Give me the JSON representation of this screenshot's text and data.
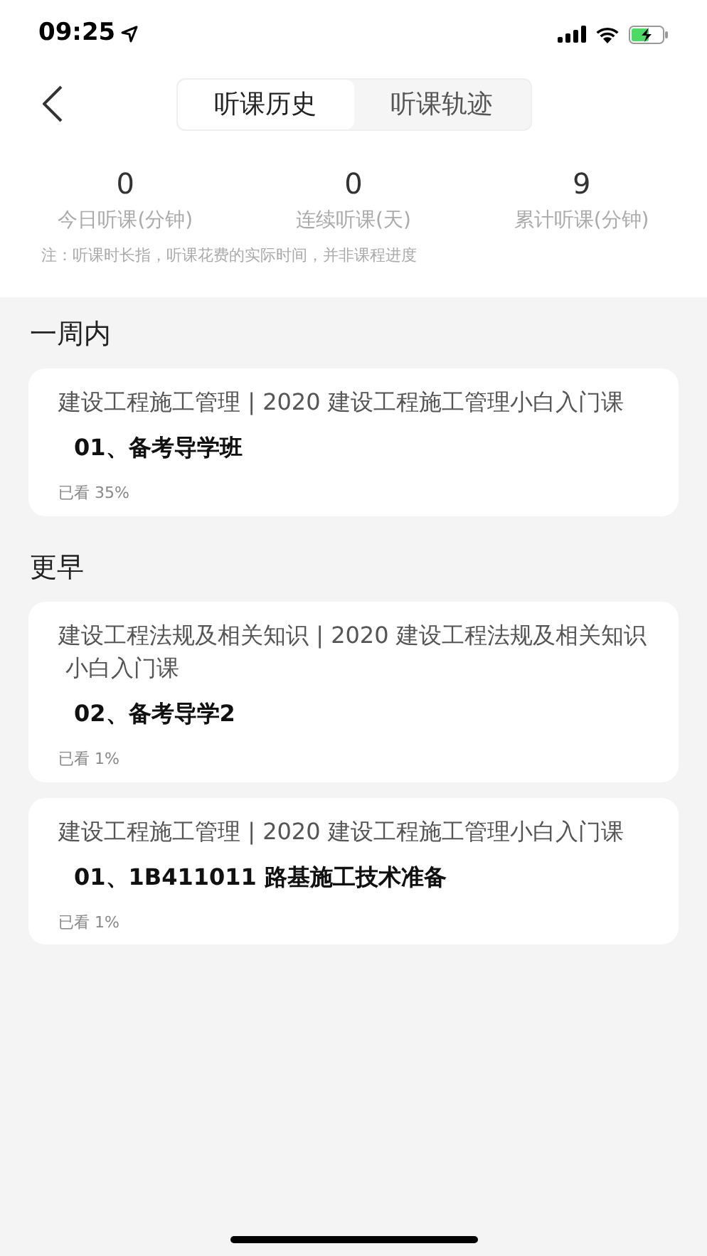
{
  "status_bar": {
    "time": "09:25"
  },
  "tabs": [
    {
      "label": "听课历史",
      "selected": true
    },
    {
      "label": "听课轨迹",
      "selected": false
    }
  ],
  "stats": [
    {
      "value": "0",
      "label": "今日听课(分钟)"
    },
    {
      "value": "0",
      "label": "连续听课(天)"
    },
    {
      "value": "9",
      "label": "累计听课(分钟)"
    }
  ],
  "note": "注：听课时长指，听课花费的实际时间，并非课程进度",
  "sections": [
    {
      "heading": "一周内",
      "items": [
        {
          "course": "建设工程施工管理 | 2020 建设工程施工管理小白入门课",
          "lesson": "01、备考导学班",
          "progress": "已看 35%"
        }
      ]
    },
    {
      "heading": "更早",
      "items": [
        {
          "course": "建设工程法规及相关知识 | 2020 建设工程法规及相关知识小白入门课",
          "lesson": "02、备考导学2",
          "progress": "已看 1%"
        },
        {
          "course": "建设工程施工管理 | 2020 建设工程施工管理小白入门课",
          "lesson": "01、1B411011 路基施工技术准备",
          "progress": "已看 1%"
        }
      ]
    }
  ]
}
